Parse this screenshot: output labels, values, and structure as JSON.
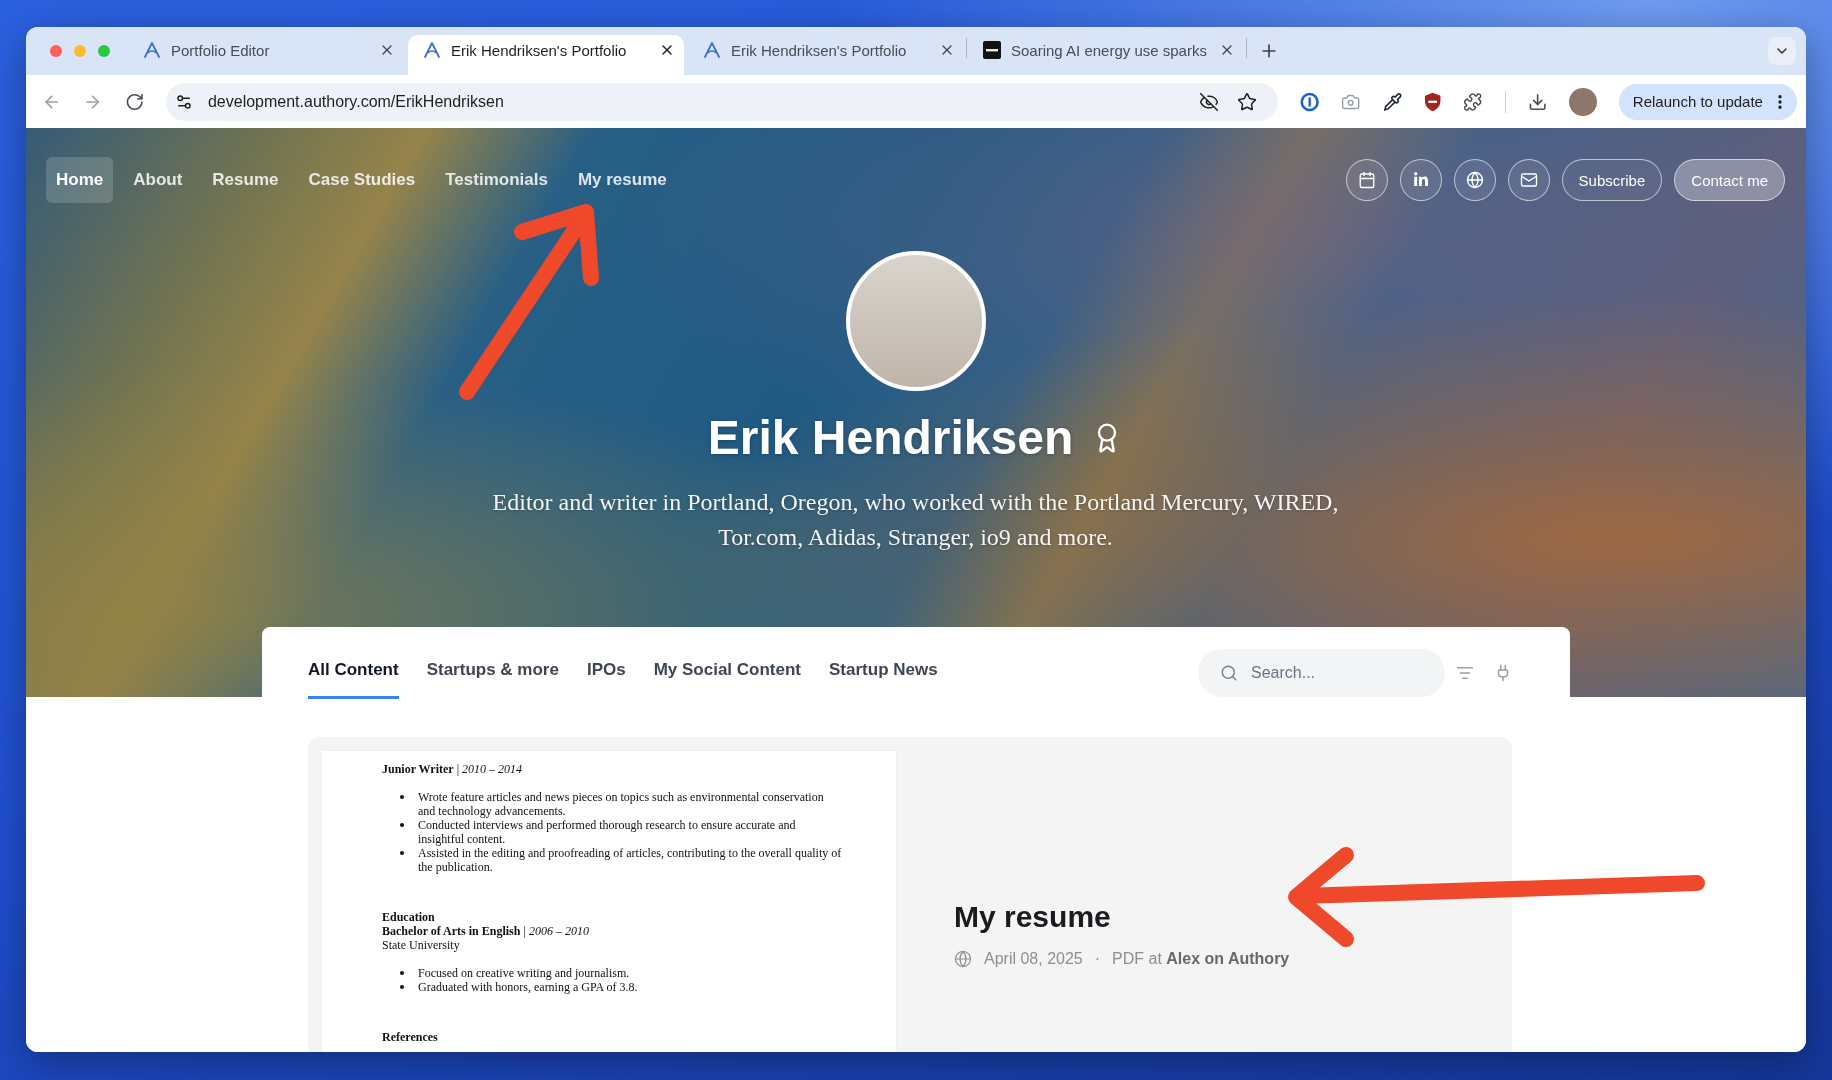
{
  "browser": {
    "tabs": [
      {
        "kind": "authory",
        "title": "Portfolio Editor",
        "selected": false
      },
      {
        "kind": "authory",
        "title": "Erik Hendriksen's Portfolio",
        "selected": true
      },
      {
        "kind": "authory",
        "title": "Erik Hendriksen's Portfolio",
        "selected": false
      },
      {
        "kind": "news",
        "title": "Soaring AI energy use sparks",
        "selected": false
      }
    ],
    "address": {
      "url": "development.authory.com/ErikHendriksen"
    },
    "relaunch_button": {
      "label": "Relaunch to update"
    }
  },
  "site_nav": {
    "links": [
      {
        "label": "Home",
        "selected": true
      },
      {
        "label": "About",
        "selected": false
      },
      {
        "label": "Resume",
        "selected": false
      },
      {
        "label": "Case Studies",
        "selected": false
      },
      {
        "label": "Testimonials",
        "selected": false
      },
      {
        "label": "My resume",
        "selected": false
      }
    ],
    "buttons": [
      {
        "kind": "outline",
        "label": "Subscribe"
      },
      {
        "kind": "filled",
        "label": "Contact me"
      }
    ]
  },
  "profile": {
    "name": "Erik Hendriksen",
    "bio": "Editor and writer in Portland, Oregon, who worked with the Portland Mercury, WIRED, Tor.com, Adidas, Stranger, io9 and more."
  },
  "content_tabs": [
    {
      "label": "All Content",
      "selected": true
    },
    {
      "label": "Startups & more",
      "selected": false
    },
    {
      "label": "IPOs",
      "selected": false
    },
    {
      "label": "My Social Content",
      "selected": false
    },
    {
      "label": "Startup News",
      "selected": false
    }
  ],
  "search": {
    "placeholder": "Search..."
  },
  "items": [
    {
      "title": "My resume",
      "date": "April 08, 2025",
      "separator": "·",
      "source": "PDF at **Alex on Authory**",
      "preview": {
        "blocks": [
          {
            "kind": "line",
            "text": "**Junior Writer** | *2010 – 2014*"
          },
          {
            "kind": "bullets",
            "items": [
              "Wrote feature articles and news pieces on topics such as environmental conservation and technology advancements.",
              "Conducted interviews and performed thorough research to ensure accurate and insightful content.",
              "Assisted in the editing and proofreading of articles, contributing to the overall quality of the publication."
            ]
          },
          {
            "kind": "title",
            "text": "Education"
          },
          {
            "kind": "line",
            "text": "**Bachelor of Arts in English** | *2006 – 2010*"
          },
          {
            "kind": "line",
            "text": "State University"
          },
          {
            "kind": "bullets",
            "items": [
              "Focused on creative writing and journalism.",
              "Graduated with honors, earning a GPA of 3.8."
            ]
          },
          {
            "kind": "title",
            "text": "References"
          }
        ]
      }
    }
  ]
}
